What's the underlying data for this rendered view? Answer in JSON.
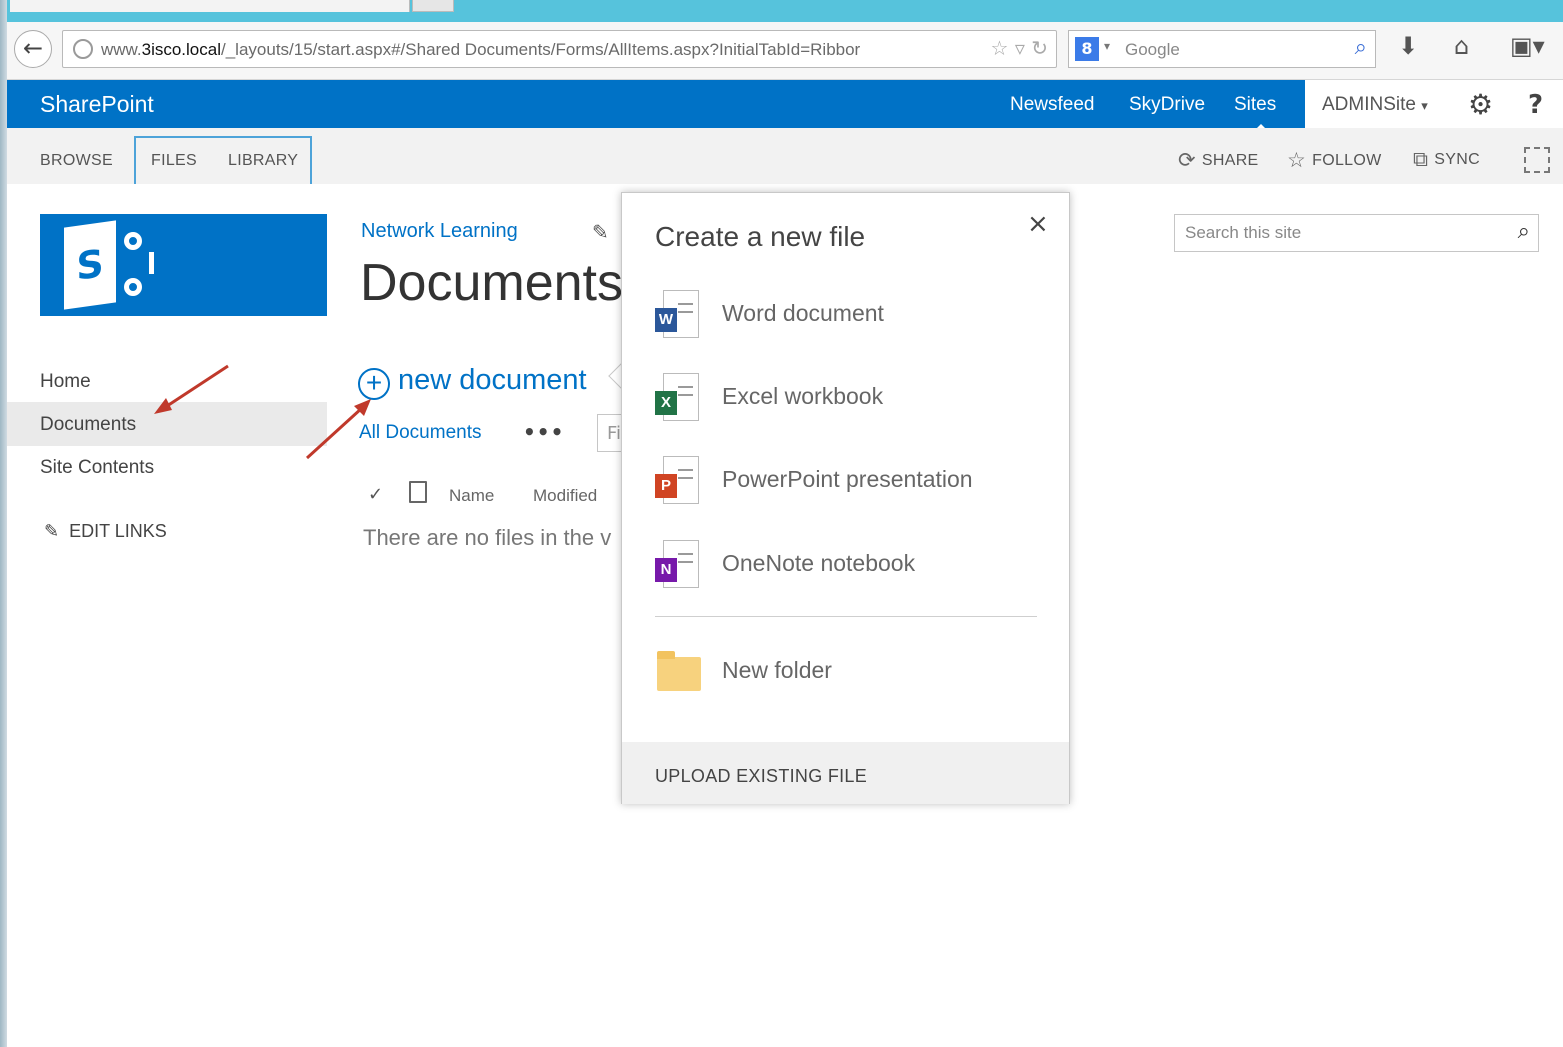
{
  "browser": {
    "url_prefix": "www.",
    "url_domain": "3isco.local",
    "url_path": "/_layouts/15/start.aspx#/Shared Documents/Forms/AllItems.aspx?InitialTabId=Ribbor",
    "search_engine_text": "Google"
  },
  "suite": {
    "brand": "SharePoint",
    "links": [
      "Newsfeed",
      "SkyDrive",
      "Sites"
    ],
    "user": "ADMINSite"
  },
  "ribbon": {
    "tabs": [
      "BROWSE",
      "FILES",
      "LIBRARY"
    ],
    "actions": [
      "SHARE",
      "FOLLOW",
      "SYNC"
    ]
  },
  "nav": {
    "items": [
      "Home",
      "Documents",
      "Site Contents"
    ],
    "edit_links": "EDIT LINKS"
  },
  "main": {
    "breadcrumb": "Network Learning",
    "title": "Documents",
    "new_document": "new document",
    "view_name": "All Documents",
    "more": "•••",
    "find_partial": "Fi",
    "columns": [
      "Name",
      "Modified"
    ],
    "empty_message": "There are no files in the v"
  },
  "search": {
    "placeholder": "Search this site"
  },
  "callout": {
    "title": "Create a new file",
    "close": "×",
    "options": [
      {
        "label": "Word document",
        "badge": "W",
        "color": "#2b579a"
      },
      {
        "label": "Excel workbook",
        "badge": "X",
        "color": "#217346"
      },
      {
        "label": "PowerPoint presentation",
        "badge": "P",
        "color": "#d04423"
      },
      {
        "label": "OneNote notebook",
        "badge": "N",
        "color": "#7719aa"
      }
    ],
    "folder": "New folder",
    "upload": "UPLOAD EXISTING FILE"
  },
  "colors": {
    "suite_blue": "#0072c6",
    "annotation_arrow": "#c0392b"
  }
}
